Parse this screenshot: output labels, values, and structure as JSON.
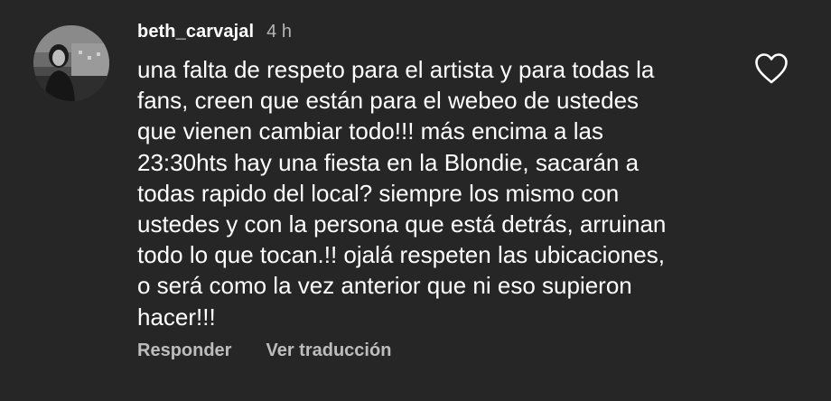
{
  "comment": {
    "username": "beth_carvajal",
    "timestamp": "4 h",
    "avatar_icon": "user-avatar-photo",
    "like_icon": "heart-outline-icon",
    "lines": [
      "una falta de respeto para el artista y  para todas la",
      "fans, creen que están para el webeo de ustedes",
      "que vienen cambiar todo!!! más encima a las",
      "23:30hts hay una fiesta en la Blondie, sacarán a",
      "todas rapido del local? siempre los mismo con",
      "ustedes y con la persona que está detrás, arruinan",
      "todo lo que tocan.!! ojalá respeten las ubicaciones,",
      "o será como la vez anterior que ni eso supieron",
      "hacer!!!"
    ],
    "actions": {
      "reply_label": "Responder",
      "translate_label": "Ver traducción"
    }
  },
  "colors": {
    "background": "#262626",
    "text": "#ffffff",
    "secondary_text": "#b5b5b5"
  }
}
